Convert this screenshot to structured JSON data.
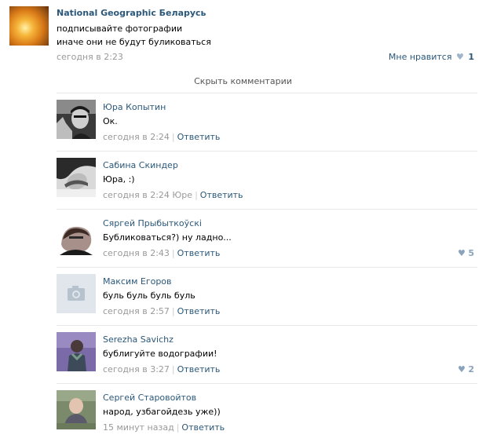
{
  "post": {
    "author": "National Geographic Беларусь",
    "text_line1": "подписывайте фотографии",
    "text_line2": "иначе они не будут буликоваться",
    "time": "сегодня в 2:23",
    "like_label": "Мне нравится",
    "like_count": "1"
  },
  "hide_comments": "Скрыть комментарии",
  "comments": [
    {
      "name": "Юра Копытин",
      "text": "Ок.",
      "time": "сегодня в 2:24",
      "reply_to": "",
      "reply": "Ответить",
      "likes": ""
    },
    {
      "name": "Сабина Скиндер",
      "text": "Юра, :)",
      "time": "сегодня в 2:24",
      "reply_to": "Юре",
      "reply": "Ответить",
      "likes": ""
    },
    {
      "name": "Сяргей Прыбыткоўскі",
      "text": "Бубликоваться?) ну ладно...",
      "time": "сегодня в 2:43",
      "reply_to": "",
      "reply": "Ответить",
      "likes": "5"
    },
    {
      "name": "Максим Егоров",
      "text": "буль буль буль буль",
      "time": "сегодня в 2:57",
      "reply_to": "",
      "reply": "Ответить",
      "likes": ""
    },
    {
      "name": "Serezha Savichz",
      "text": "бублигуйте водографии!",
      "time": "сегодня в 3:27",
      "reply_to": "",
      "reply": "Ответить",
      "likes": "2"
    },
    {
      "name": "Сергей Старовойтов",
      "text": "народ, узбагойдезь уже))",
      "time": "15 минут назад",
      "reply_to": "",
      "reply": "Ответить",
      "likes": ""
    }
  ],
  "colors": {
    "link": "#2b587a",
    "meta": "#999999",
    "separator": "#e7e8ec"
  }
}
